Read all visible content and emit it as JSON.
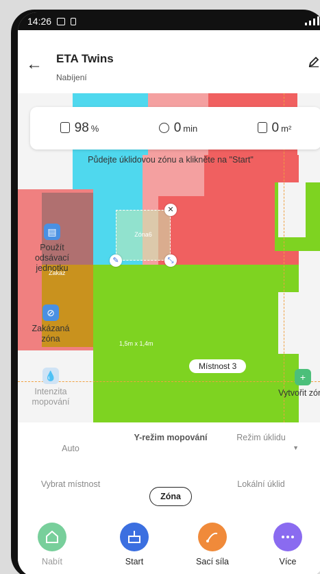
{
  "status_bar": {
    "time": "14:26"
  },
  "header": {
    "title": "ETA Twins",
    "subtitle": "Nabíjení"
  },
  "stats": {
    "battery_value": "98",
    "battery_unit": "%",
    "time_value": "0",
    "time_unit": "min",
    "area_value": "0",
    "area_unit": "m²"
  },
  "map": {
    "hint": "Půdejte úklidovou zónu a klikněte na \"Start\"",
    "zone_label": "Zóna6",
    "zone_size": "1,5m x 1,4m",
    "room_label": "Místnost 3",
    "forbidden_label": "Zakaz"
  },
  "tools": {
    "suction_unit": "Použít odsávací jednotku",
    "forbidden_zone": "Zakázaná zóna",
    "mop_intensity": "Intenzita mopování",
    "create_zone": "Vytvořit zónu"
  },
  "modes": {
    "auto": "Auto",
    "y_mode": "Y-režim mopování",
    "clean_mode": "Režim úklidu",
    "select_room": "Vybrat místnost",
    "zone": "Zóna",
    "local_clean": "Lokální úklid"
  },
  "bottom": {
    "charge": "Nabít",
    "start": "Start",
    "suction": "Sací síla",
    "more": "Více"
  },
  "colors": {
    "green_room": "#7ed321",
    "cyan_room": "#4fd8ee",
    "pink_room": "#f4a0a0",
    "red_room": "#f06060",
    "accent_blue": "#3b6fe0",
    "accent_orange": "#f08a3a",
    "accent_purple": "#8a6bf0",
    "accent_green": "#4cbf7a"
  }
}
